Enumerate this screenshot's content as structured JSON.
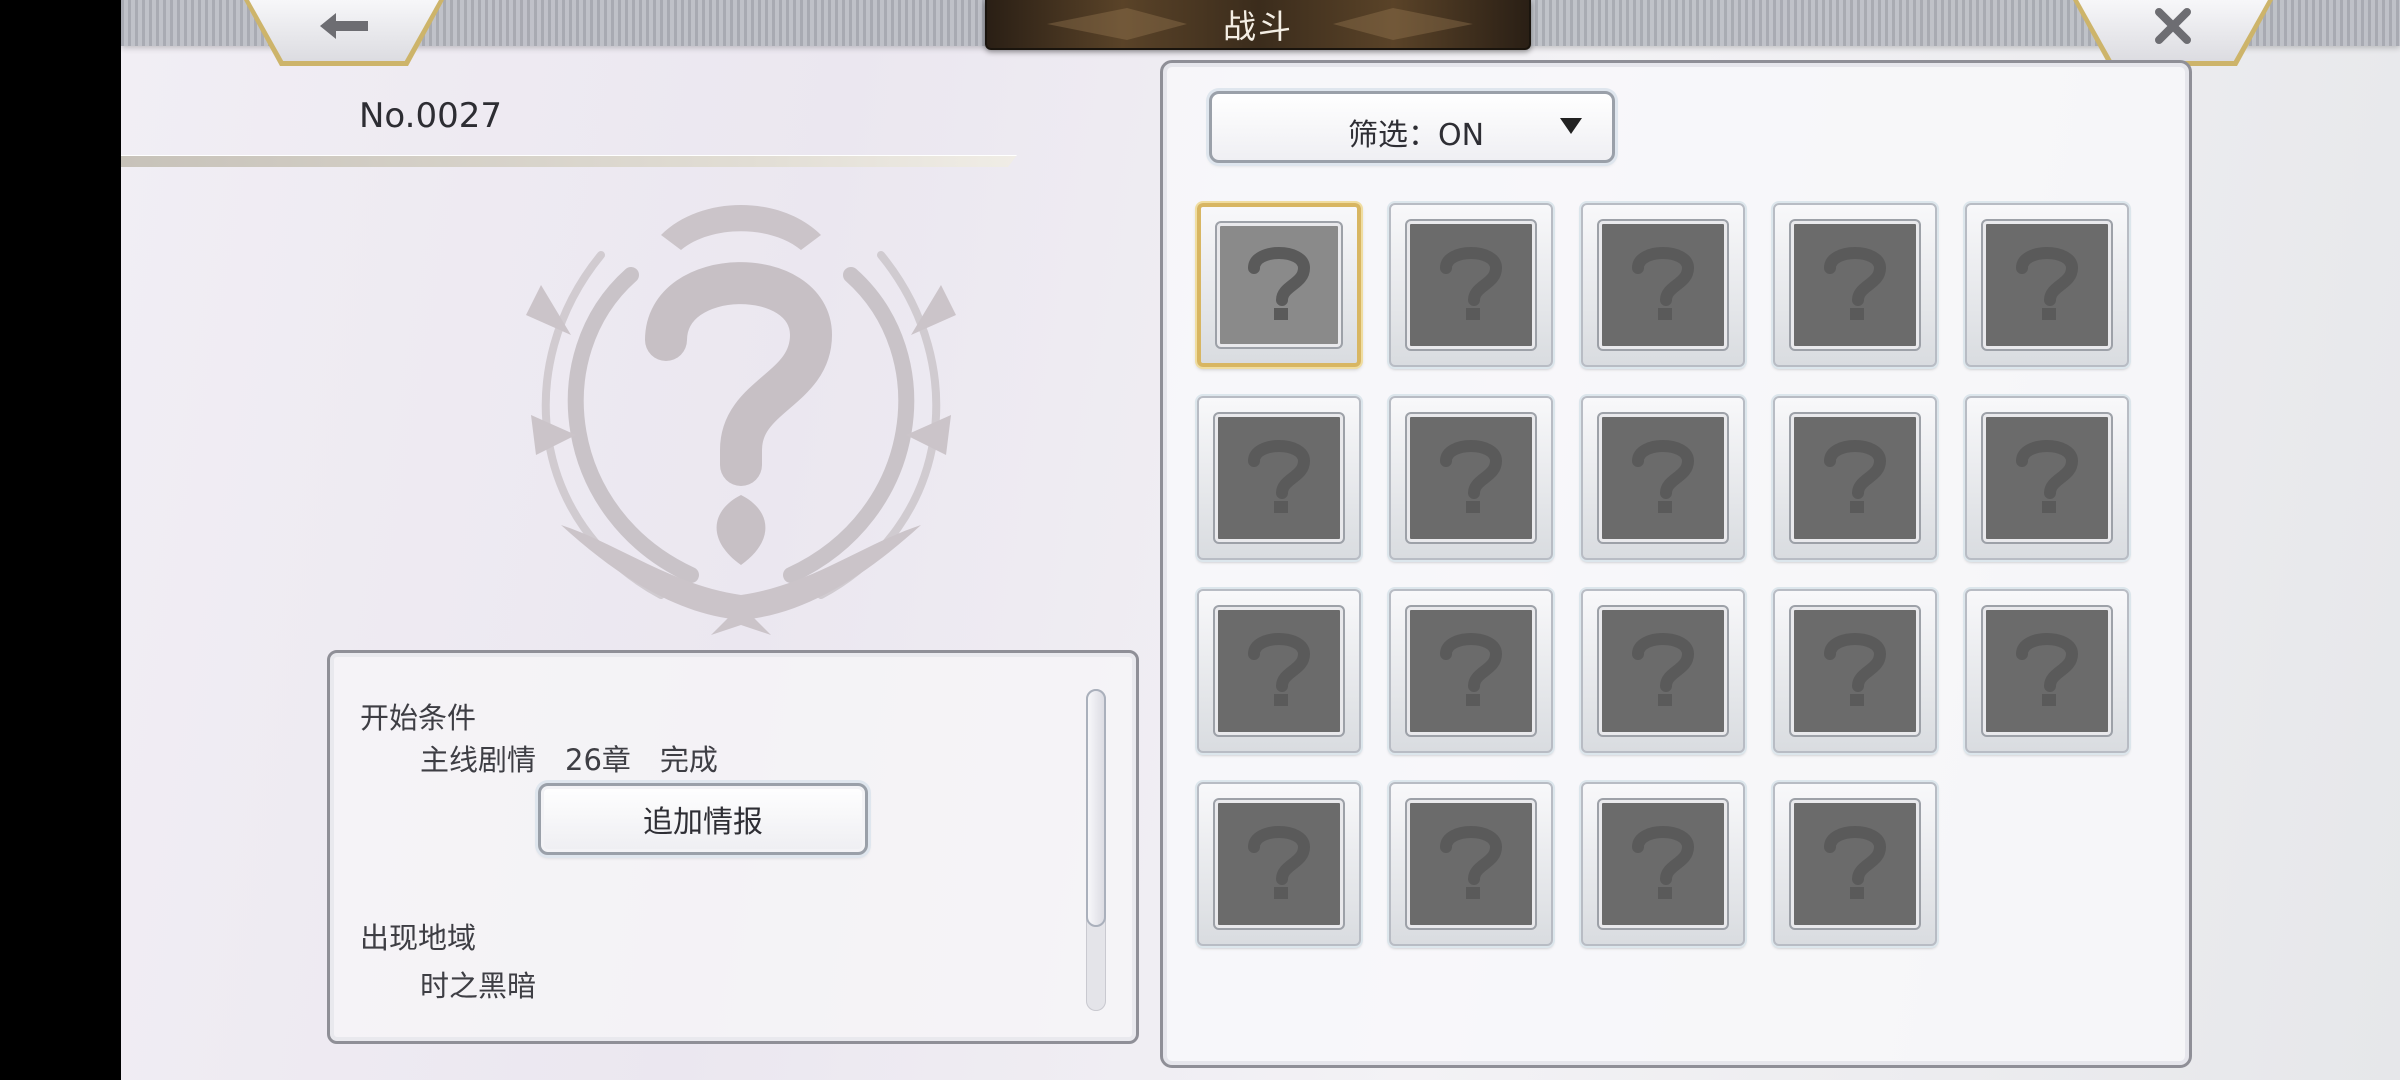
{
  "header": {
    "title": "战斗",
    "back_icon": "arrow-left-icon",
    "close_icon": "close-icon"
  },
  "record": {
    "number": "No.0027",
    "emblem_icon": "unknown-question-emblem-icon"
  },
  "info": {
    "start_condition_label": "开始条件",
    "start_condition_value": "主线剧情　26章　完成",
    "extra_info_button": "追加情报",
    "region_label": "出现地域",
    "region_value": "时之黑暗"
  },
  "filter": {
    "label": "筛选：ON",
    "arrow_icon": "dropdown-triangle-icon"
  },
  "grid": {
    "columns": 5,
    "slot_count": 19,
    "selected_index": 0,
    "slot_icon": "question-mark-icon"
  },
  "colors": {
    "accent_gold": "#d8b662",
    "title_plate": "#3b2c1c",
    "slot_fill": "#6b6b6b"
  }
}
